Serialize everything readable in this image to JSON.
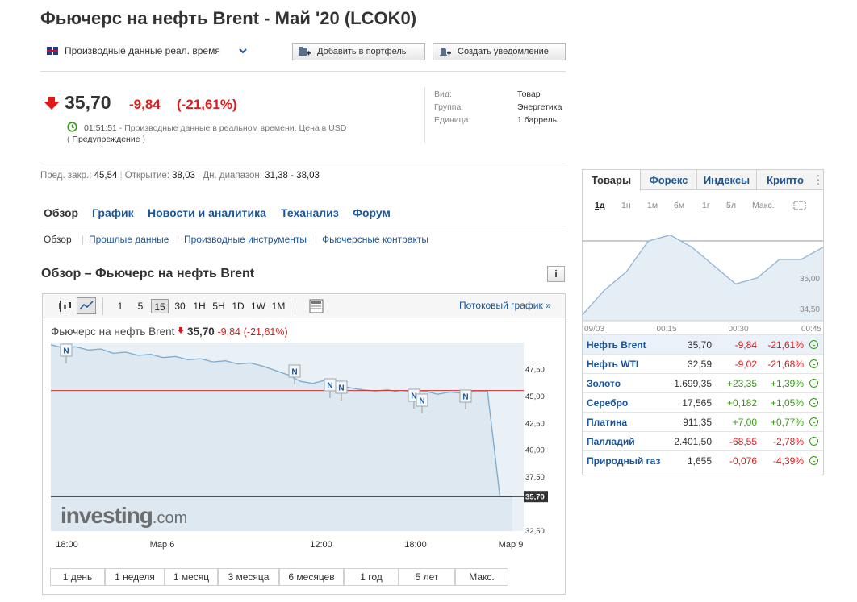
{
  "header": {
    "title": "Фьючерс на нефть Brent - Май '20 (LCOK0)",
    "data_source": "Производные данные реал. время",
    "add_portfolio": "Добавить в портфель",
    "create_alert": "Создать уведомление"
  },
  "quote": {
    "price": "35,70",
    "change": "-9,84",
    "change_pct": "(-21,61%)",
    "time": "01:51:51",
    "note": "- Производные данные в реальном времени. Цена в USD",
    "warning_open": "(",
    "warning": "Предупреждение",
    "warning_close": ")"
  },
  "info": {
    "rows": [
      {
        "label": "Вид:",
        "value": "Товар"
      },
      {
        "label": "Группа:",
        "value": "Энергетика"
      },
      {
        "label": "Единица:",
        "value": "1 баррель"
      }
    ]
  },
  "stats": {
    "prev_label": "Пред. закр.:",
    "prev_value": "45,54",
    "open_label": "Открытие:",
    "open_value": "38,03",
    "range_label": "Дн. диапазон:",
    "range_value": "31,38 - 38,03"
  },
  "tabs": [
    "Обзор",
    "График",
    "Новости и аналитика",
    "Теханализ",
    "Форум"
  ],
  "subtabs": [
    "Обзор",
    "Прошлые данные",
    "Производные инструменты",
    "Фьючерсные контракты"
  ],
  "section_title": "Обзор – Фьючерс на нефть Brent",
  "toolbar": {
    "intervals": [
      "1",
      "5",
      "15",
      "30",
      "1Н",
      "5Н",
      "1D",
      "1W",
      "1M"
    ],
    "selected": "15",
    "streaming": "Потоковый график »"
  },
  "chart_data": {
    "type": "line",
    "title": "Фьючерс на нефть Brent",
    "last": "35,70",
    "change": "-9,84",
    "change_pct": "(-21,61%)",
    "x_ticks": [
      "18:00",
      "Мар 6",
      "12:00",
      "18:00",
      "Мар 9"
    ],
    "y_ticks": [
      "47,50",
      "45,00",
      "42,50",
      "40,00",
      "37,50",
      "32,50"
    ],
    "ylim": [
      32.5,
      50
    ],
    "prev_close": 45.54,
    "last_value": 35.7,
    "last_label": "35,70",
    "series": [
      {
        "values": [
          49.8,
          49.5,
          49.6,
          49.3,
          49.4,
          49.0,
          49.1,
          48.8,
          48.9,
          48.6,
          48.7,
          48.4,
          48.5,
          48.2,
          48.3,
          48.0,
          48.1,
          47.8,
          47.4,
          47.0,
          46.4,
          46.2,
          46.5,
          46.0,
          45.8,
          45.6,
          45.5,
          45.6,
          45.4,
          45.5,
          45.5,
          45.2,
          45.4,
          45.3,
          45.5,
          45.5,
          35.7,
          35.7
        ]
      }
    ],
    "news_markers": [
      "N",
      "N",
      "N",
      "N",
      "N",
      "N",
      "N"
    ],
    "watermark": "investing",
    "watermark_suffix": ".com"
  },
  "ranges": [
    "1 день",
    "1 неделя",
    "1 месяц",
    "3 месяца",
    "6 месяцев",
    "1 год",
    "5 лет",
    "Макс."
  ],
  "right_panel": {
    "tabs": [
      "Товары",
      "Форекс",
      "Индексы",
      "Крипто"
    ],
    "periods": [
      "1д",
      "1н",
      "1м",
      "6м",
      "1г",
      "5л",
      "Макс."
    ],
    "mini_chart": {
      "type": "line",
      "y_ticks": [
        "35,00",
        "34,50"
      ],
      "x_ticks": [
        "09/03",
        "00:15",
        "00:30",
        "00:45"
      ],
      "values": [
        34.4,
        34.8,
        35.1,
        35.6,
        35.7,
        35.5,
        35.2,
        34.9,
        35.0,
        35.3,
        35.3,
        35.5
      ]
    },
    "rows": [
      {
        "name": "Нефть Brent",
        "last": "35,70",
        "chg": "-9,84",
        "pct": "-21,61%",
        "dir": "neg"
      },
      {
        "name": "Нефть WTI",
        "last": "32,59",
        "chg": "-9,02",
        "pct": "-21,68%",
        "dir": "neg"
      },
      {
        "name": "Золото",
        "last": "1.699,35",
        "chg": "+23,35",
        "pct": "+1,39%",
        "dir": "pos"
      },
      {
        "name": "Серебро",
        "last": "17,565",
        "chg": "+0,182",
        "pct": "+1,05%",
        "dir": "pos"
      },
      {
        "name": "Платина",
        "last": "911,35",
        "chg": "+7,00",
        "pct": "+0,77%",
        "dir": "pos"
      },
      {
        "name": "Палладий",
        "last": "2.401,50",
        "chg": "-68,55",
        "pct": "-2,78%",
        "dir": "neg"
      },
      {
        "name": "Природный газ",
        "last": "1,655",
        "chg": "-0,076",
        "pct": "-4,39%",
        "dir": "neg"
      }
    ]
  },
  "colors": {
    "accent": "#1a5699",
    "negative": "#e01a1a",
    "positive": "#3a9a1a",
    "chart_line": "#7aaad0",
    "chart_fill": "#dde8f1"
  }
}
